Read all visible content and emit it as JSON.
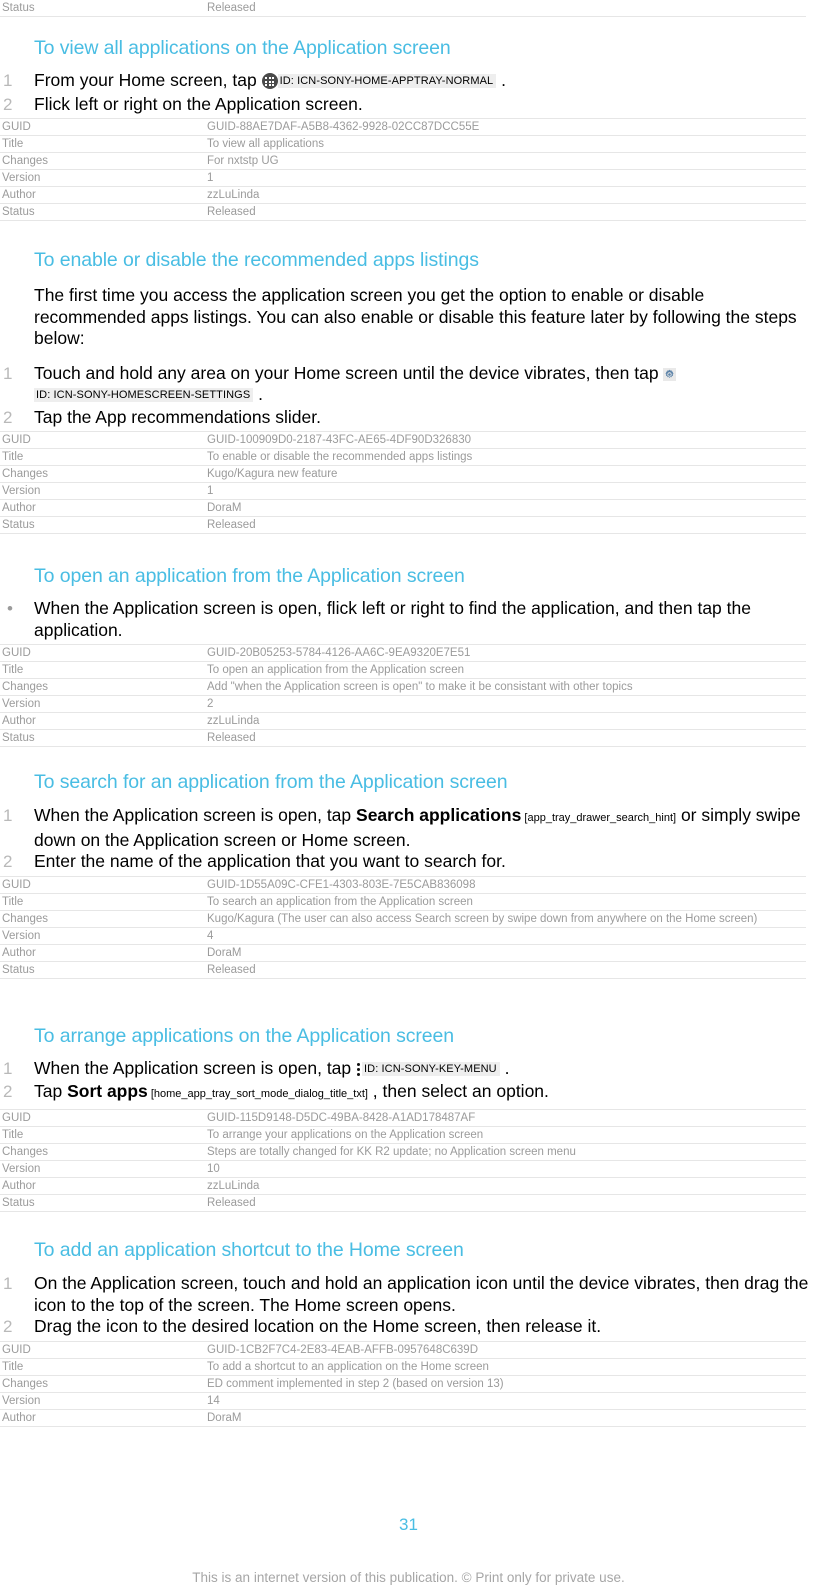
{
  "page": {
    "number": "31",
    "disclaimer": "This is an internet version of this publication. © Print only for private use.",
    "accent_color": "#49bde3",
    "meta_text_color": "#9b9b9b"
  },
  "top_partial_table": {
    "rows": [
      {
        "key": "Status",
        "value": "Released"
      }
    ]
  },
  "sections": [
    {
      "heading": "To view all applications on the Application screen",
      "list_type": "ordered",
      "steps": [
        {
          "number": "1",
          "parts": [
            {
              "type": "text",
              "text": "From your Home screen, tap "
            },
            {
              "type": "icon",
              "icon": "app-tray-icon"
            },
            {
              "type": "uitoken",
              "text": "ID: ICN-SONY-HOME-APPTRAY-NORMAL"
            },
            {
              "type": "text",
              "text": " ."
            }
          ]
        },
        {
          "number": "2",
          "parts": [
            {
              "type": "text",
              "text": "Flick left or right on the Application screen."
            }
          ]
        }
      ],
      "meta": {
        "rows": [
          {
            "key": "GUID",
            "value": "GUID-88AE7DAF-A5B8-4362-9928-02CC87DCC55E"
          },
          {
            "key": "Title",
            "value": "To view all applications"
          },
          {
            "key": "Changes",
            "value": "For nxtstp UG"
          },
          {
            "key": "Version",
            "value": "1"
          },
          {
            "key": "Author",
            "value": "zzLuLinda"
          },
          {
            "key": "Status",
            "value": "Released"
          }
        ]
      }
    },
    {
      "heading": "To enable or disable the recommended apps listings",
      "paragraph": "The first time you access the application screen you get the option to enable or disable recommended apps listings. You can also enable or disable this feature later by following the steps below:",
      "list_type": "ordered",
      "steps": [
        {
          "number": "1",
          "parts": [
            {
              "type": "text",
              "text": "Touch and hold any area on your Home screen until the device vibrates, then tap "
            },
            {
              "type": "icon",
              "icon": "gear-icon"
            },
            {
              "type": "uitoken",
              "text": "ID: ICN-SONY-HOMESCREEN-SETTINGS"
            },
            {
              "type": "text",
              "text": " ."
            }
          ]
        },
        {
          "number": "2",
          "parts": [
            {
              "type": "text",
              "text": "Tap the App recommendations slider."
            }
          ]
        }
      ],
      "meta": {
        "rows": [
          {
            "key": "GUID",
            "value": "GUID-100909D0-2187-43FC-AE65-4DF90D326830"
          },
          {
            "key": "Title",
            "value": "To enable or disable the recommended apps listings"
          },
          {
            "key": "Changes",
            "value": "Kugo/Kagura new feature"
          },
          {
            "key": "Version",
            "value": "1"
          },
          {
            "key": "Author",
            "value": "DoraM"
          },
          {
            "key": "Status",
            "value": "Released"
          }
        ]
      }
    },
    {
      "heading": "To open an application from the Application screen",
      "list_type": "bullet",
      "steps": [
        {
          "number": "•",
          "parts": [
            {
              "type": "text",
              "text": "When the Application screen is open, flick left or right to find the application, and then tap the application."
            }
          ]
        }
      ],
      "meta": {
        "rows": [
          {
            "key": "GUID",
            "value": "GUID-20B05253-5784-4126-AA6C-9EA9320E7E51"
          },
          {
            "key": "Title",
            "value": "To open an application from the Application screen"
          },
          {
            "key": "Changes",
            "value": "Add \"when the Application screen is open\" to make it be consistant with other topics"
          },
          {
            "key": "Version",
            "value": "2"
          },
          {
            "key": "Author",
            "value": "zzLuLinda"
          },
          {
            "key": "Status",
            "value": "Released"
          }
        ]
      }
    },
    {
      "heading": "To search for an application from the Application screen",
      "list_type": "ordered",
      "steps": [
        {
          "number": "1",
          "parts": [
            {
              "type": "text",
              "text": "When the Application screen is open, tap "
            },
            {
              "type": "bold",
              "text": "Search applications"
            },
            {
              "type": "annot",
              "text": " [app_tray_drawer_search_hint]"
            },
            {
              "type": "text",
              "text": " or simply swipe down on the Application screen or Home screen."
            }
          ]
        },
        {
          "number": "2",
          "parts": [
            {
              "type": "text",
              "text": "Enter the name of the application that you want to search for."
            }
          ]
        }
      ],
      "meta": {
        "rows": [
          {
            "key": "GUID",
            "value": "GUID-1D55A09C-CFE1-4303-803E-7E5CAB836098"
          },
          {
            "key": "Title",
            "value": "To search an application from the Application screen"
          },
          {
            "key": "Changes",
            "value": "Kugo/Kagura (The user can also access Search screen by swipe down from anywhere on the Home screen)"
          },
          {
            "key": "Version",
            "value": "4"
          },
          {
            "key": "Author",
            "value": "DoraM"
          },
          {
            "key": "Status",
            "value": "Released"
          }
        ]
      }
    },
    {
      "heading": "To arrange applications on the Application screen",
      "list_type": "ordered",
      "steps": [
        {
          "number": "1",
          "parts": [
            {
              "type": "text",
              "text": "When the Application screen is open, tap "
            },
            {
              "type": "icon",
              "icon": "kebab-menu-icon"
            },
            {
              "type": "uitoken",
              "text": "ID: ICN-SONY-KEY-MENU"
            },
            {
              "type": "text",
              "text": " ."
            }
          ]
        },
        {
          "number": "2",
          "parts": [
            {
              "type": "text",
              "text": "Tap "
            },
            {
              "type": "bold",
              "text": "Sort apps"
            },
            {
              "type": "annot",
              "text": " [home_app_tray_sort_mode_dialog_title_txt]"
            },
            {
              "type": "text",
              "text": " , then select an option."
            }
          ]
        }
      ],
      "meta": {
        "rows": [
          {
            "key": "GUID",
            "value": "GUID-115D9148-D5DC-49BA-8428-A1AD178487AF"
          },
          {
            "key": "Title",
            "value": "To arrange your applications on the Application screen"
          },
          {
            "key": "Changes",
            "value": "Steps are totally changed for KK R2 update; no Application screen menu"
          },
          {
            "key": "Version",
            "value": "10"
          },
          {
            "key": "Author",
            "value": "zzLuLinda"
          },
          {
            "key": "Status",
            "value": "Released"
          }
        ]
      }
    },
    {
      "heading": "To add an application shortcut to the Home screen",
      "list_type": "ordered",
      "steps": [
        {
          "number": "1",
          "parts": [
            {
              "type": "text",
              "text": "On the Application screen, touch and hold an application icon until the device vibrates, then drag the icon to the top of the screen. The Home screen opens."
            }
          ]
        },
        {
          "number": "2",
          "parts": [
            {
              "type": "text",
              "text": "Drag the icon to the desired location on the Home screen, then release it."
            }
          ]
        }
      ],
      "meta": {
        "rows": [
          {
            "key": "GUID",
            "value": "GUID-1CB2F7C4-2E83-4EAB-AFFB-0957648C639D"
          },
          {
            "key": "Title",
            "value": "To add a shortcut to an application on the Home screen"
          },
          {
            "key": "Changes",
            "value": "ED comment implemented in step 2 (based on version 13)"
          },
          {
            "key": "Version",
            "value": "14"
          },
          {
            "key": "Author",
            "value": "DoraM"
          }
        ]
      }
    }
  ]
}
